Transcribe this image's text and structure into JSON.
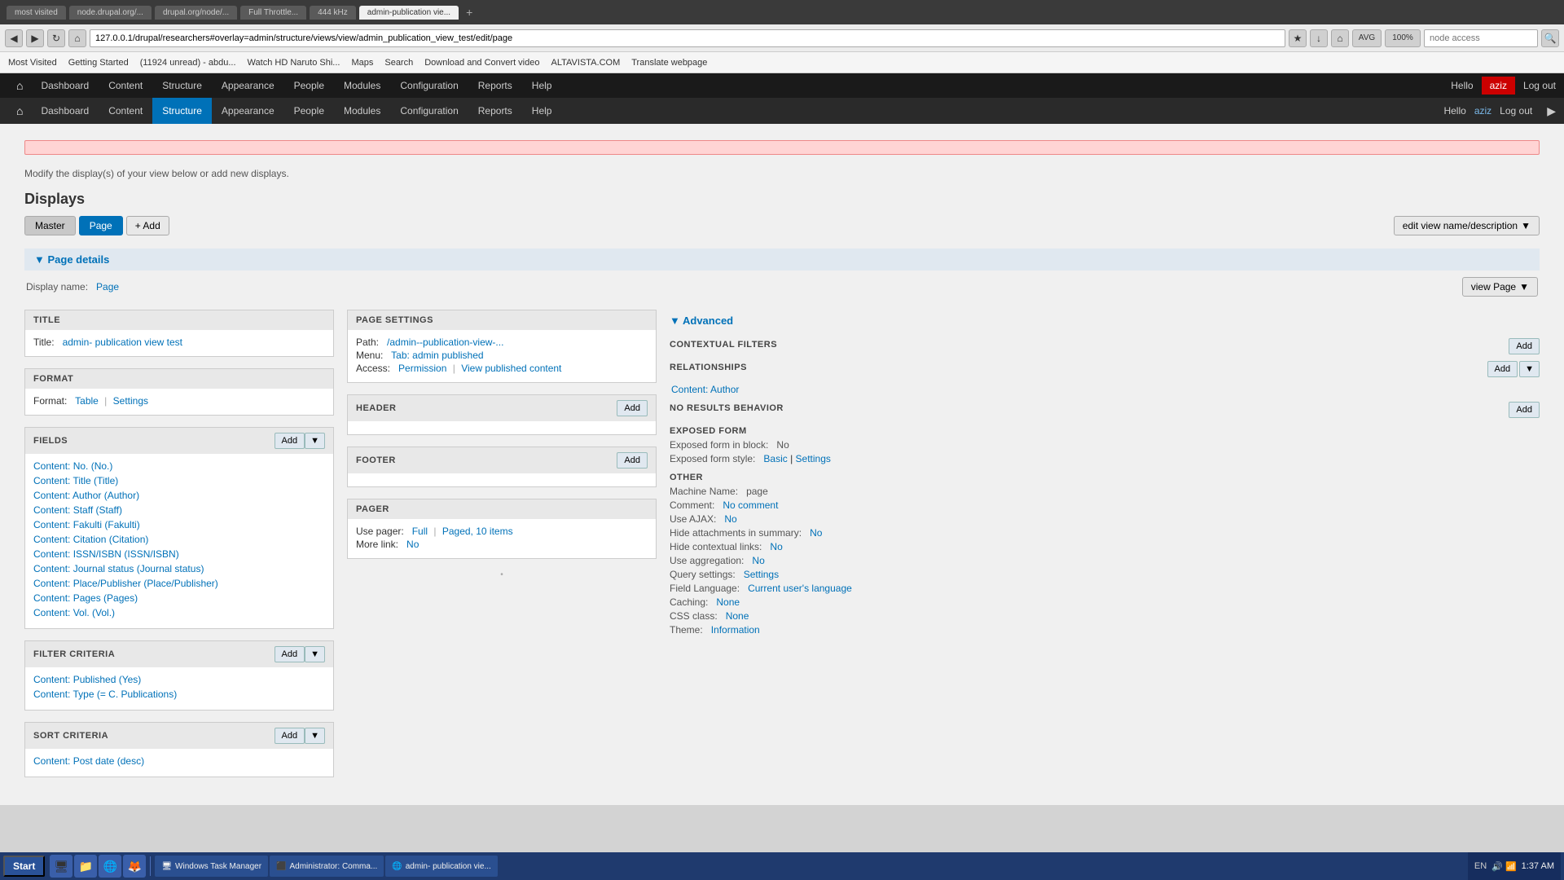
{
  "browser": {
    "tabs": [
      {
        "id": "tab1",
        "label": "most visited",
        "active": false
      },
      {
        "id": "tab2",
        "label": "node.drupal.org/...",
        "active": false
      },
      {
        "id": "tab3",
        "label": "drupal.org/node/...",
        "active": false
      },
      {
        "id": "tab4",
        "label": "Full Throttle...",
        "active": false
      },
      {
        "id": "tab5",
        "label": "444 kHz",
        "active": false
      },
      {
        "id": "tab6",
        "label": "",
        "active": false
      },
      {
        "id": "tab7",
        "label": "admin-publication vie...",
        "active": true
      }
    ],
    "address": "127.0.0.1/drupal/researchers#overlay=admin/structure/views/view/admin_publication_view_test/edit/page",
    "search_placeholder": "node access"
  },
  "bookmarks": [
    {
      "id": "bk1",
      "label": "Most Visited"
    },
    {
      "id": "bk2",
      "label": "Getting Started"
    },
    {
      "id": "bk3",
      "label": "(11924 unread) - abdu..."
    },
    {
      "id": "bk4",
      "label": "Watch HD Naruto Shi..."
    },
    {
      "id": "bk5",
      "label": "Maps"
    },
    {
      "id": "bk6",
      "label": "Search"
    },
    {
      "id": "bk7",
      "label": "Download and Convert video"
    },
    {
      "id": "bk8",
      "label": "ALTAVISTA.COM"
    },
    {
      "id": "bk9",
      "label": "Translate webpage"
    }
  ],
  "drupal_nav1": {
    "home_icon": "⌂",
    "items": [
      {
        "id": "dashboard1",
        "label": "Dashboard"
      },
      {
        "id": "content1",
        "label": "Content"
      },
      {
        "id": "structure1",
        "label": "Structure"
      },
      {
        "id": "appearance1",
        "label": "Appearance"
      },
      {
        "id": "people1",
        "label": "People"
      },
      {
        "id": "modules1",
        "label": "Modules"
      },
      {
        "id": "configuration1",
        "label": "Configuration"
      },
      {
        "id": "reports1",
        "label": "Reports"
      },
      {
        "id": "help1",
        "label": "Help"
      }
    ],
    "user_label": "Hello",
    "user_name": "aziz",
    "logout_label": "Log out"
  },
  "drupal_nav2": {
    "home_icon": "⌂",
    "items": [
      {
        "id": "dashboard2",
        "label": "Dashboard",
        "active": false
      },
      {
        "id": "content2",
        "label": "Content",
        "active": false
      },
      {
        "id": "structure2",
        "label": "Structure",
        "active": true
      },
      {
        "id": "appearance2",
        "label": "Appearance",
        "active": false
      },
      {
        "id": "people2",
        "label": "People",
        "active": false
      },
      {
        "id": "modules2",
        "label": "Modules",
        "active": false
      },
      {
        "id": "configuration2",
        "label": "Configuration",
        "active": false
      },
      {
        "id": "reports2",
        "label": "Reports",
        "active": false
      },
      {
        "id": "help2",
        "label": "Help",
        "active": false
      }
    ],
    "user_label": "Hello",
    "user_name": "aziz",
    "logout_label": "Log out"
  },
  "page": {
    "modify_text": "Modify the display(s) of your view below or add new displays.",
    "displays_label": "Displays",
    "tabs": {
      "master_label": "Master",
      "page_label": "Page",
      "add_label": "+ Add"
    },
    "edit_view_btn": "edit view name/description",
    "page_details_label": "▼ Page details",
    "display_name_label": "Display name:",
    "display_name_value": "Page",
    "view_page_btn": "view Page",
    "title_section": {
      "header": "TITLE",
      "title_label": "Title:",
      "title_value": "admin- publication view test"
    },
    "format_section": {
      "header": "FORMAT",
      "format_label": "Format:",
      "table_link": "Table",
      "sep": "|",
      "settings_link": "Settings"
    },
    "fields_section": {
      "header": "FIELDS",
      "add_btn": "Add",
      "items": [
        "Content: No. (No.)",
        "Content: Title (Title)",
        "Content: Author (Author)",
        "Content: Staff (Staff)",
        "Content: Fakulti (Fakulti)",
        "Content: Citation (Citation)",
        "Content: ISSN/ISBN (ISSN/ISBN)",
        "Content: Journal status (Journal status)",
        "Content: Place/Publisher (Place/Publisher)",
        "Content: Pages (Pages)",
        "Content: Vol. (Vol.)"
      ]
    },
    "filter_criteria_section": {
      "header": "FILTER CRITERIA",
      "add_btn": "Add",
      "items": [
        "Content: Published (Yes)",
        "Content: Type (= C. Publications)"
      ]
    },
    "sort_criteria_section": {
      "header": "SORT CRITERIA",
      "add_btn": "Add",
      "items": [
        "Content: Post date (desc)"
      ]
    },
    "page_settings_section": {
      "header": "PAGE SETTINGS",
      "path_label": "Path:",
      "path_value": "/admin--publication-view-...",
      "menu_label": "Menu:",
      "menu_value": "Tab: admin published",
      "access_label": "Access:",
      "permission_link": "Permission",
      "sep": "|",
      "view_published_link": "View published content"
    },
    "header_section": {
      "header": "HEADER",
      "add_btn": "Add"
    },
    "footer_section": {
      "header": "FOOTER",
      "add_btn": "Add"
    },
    "pager_section": {
      "header": "PAGER",
      "use_pager_label": "Use pager:",
      "full_link": "Full",
      "sep": "|",
      "paged_value": "Paged, 10 items",
      "more_link_label": "More link:",
      "more_link_value": "No"
    },
    "advanced_section": {
      "header": "▼ Advanced",
      "contextual_filters_header": "CONTEXTUAL FILTERS",
      "contextual_add_btn": "Add",
      "relationships_header": "RELATIONSHIPS",
      "relationships_add_btn": "Add",
      "relationships_value": "Content: Author",
      "no_results_header": "NO RESULTS BEHAVIOR",
      "no_results_add_btn": "Add",
      "exposed_form_header": "EXPOSED FORM",
      "exposed_form_block_label": "Exposed form in block:",
      "exposed_form_block_value": "No",
      "exposed_form_style_label": "Exposed form style:",
      "exposed_form_style_link": "Basic",
      "exposed_form_style_sep": "|",
      "exposed_form_settings_link": "Settings",
      "other_header": "OTHER",
      "machine_name_label": "Machine Name:",
      "machine_name_value": "page",
      "comment_label": "Comment:",
      "comment_value": "No comment",
      "use_ajax_label": "Use AJAX:",
      "use_ajax_value": "No",
      "hide_attachments_label": "Hide attachments in summary:",
      "hide_attachments_value": "No",
      "hide_contextual_label": "Hide contextual links:",
      "hide_contextual_value": "No",
      "use_aggregation_label": "Use aggregation:",
      "use_aggregation_value": "No",
      "query_settings_label": "Query settings:",
      "query_settings_link": "Settings",
      "field_language_label": "Field Language:",
      "field_language_value": "Current user's language",
      "caching_label": "Caching:",
      "caching_value": "None",
      "css_class_label": "CSS class:",
      "css_class_value": "None",
      "theme_label": "Theme:",
      "theme_value": "Information"
    }
  },
  "taskbar": {
    "start_label": "Start",
    "items": [
      {
        "id": "tb1",
        "label": "Windows Task Manager",
        "icon": "🖥"
      },
      {
        "id": "tb2",
        "label": "Administrator: Comma...",
        "icon": "⬛"
      },
      {
        "id": "tb3",
        "label": "admin- publication vie...",
        "icon": "🌐"
      }
    ],
    "tray_label": "EN",
    "time": "1:37 AM"
  }
}
